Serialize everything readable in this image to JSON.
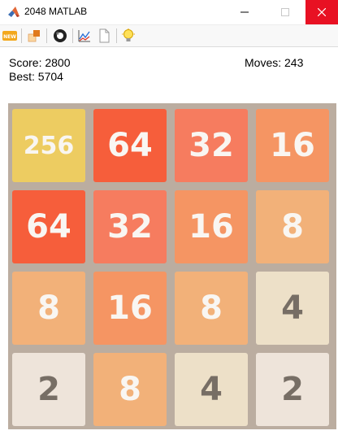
{
  "window": {
    "title": "2048 MATLAB"
  },
  "toolbar": {
    "new_label": "NEW",
    "icons": [
      "new-game-icon",
      "undo-icon",
      "ai-ball-icon",
      "stats-chart-icon",
      "blank-page-icon",
      "hint-bulb-icon"
    ]
  },
  "stats": {
    "score": "Score: 2800",
    "best": "Best: 5704",
    "moves": "Moves: 243"
  },
  "board": {
    "rows": [
      [
        "256",
        "64",
        "32",
        "16"
      ],
      [
        "64",
        "32",
        "16",
        "8"
      ],
      [
        "8",
        "16",
        "8",
        "4"
      ],
      [
        "2",
        "8",
        "4",
        "2"
      ]
    ]
  },
  "colors": {
    "board_bg": "#bbada0",
    "tile_2": "#eee4da",
    "tile_4": "#ede0c8",
    "tile_8": "#f2b179",
    "tile_16": "#f59563",
    "tile_32": "#f67c5f",
    "tile_64": "#f65e3b",
    "tile_256": "#edcc61",
    "text_dark": "#776e65",
    "text_light": "#f9f6f2"
  }
}
